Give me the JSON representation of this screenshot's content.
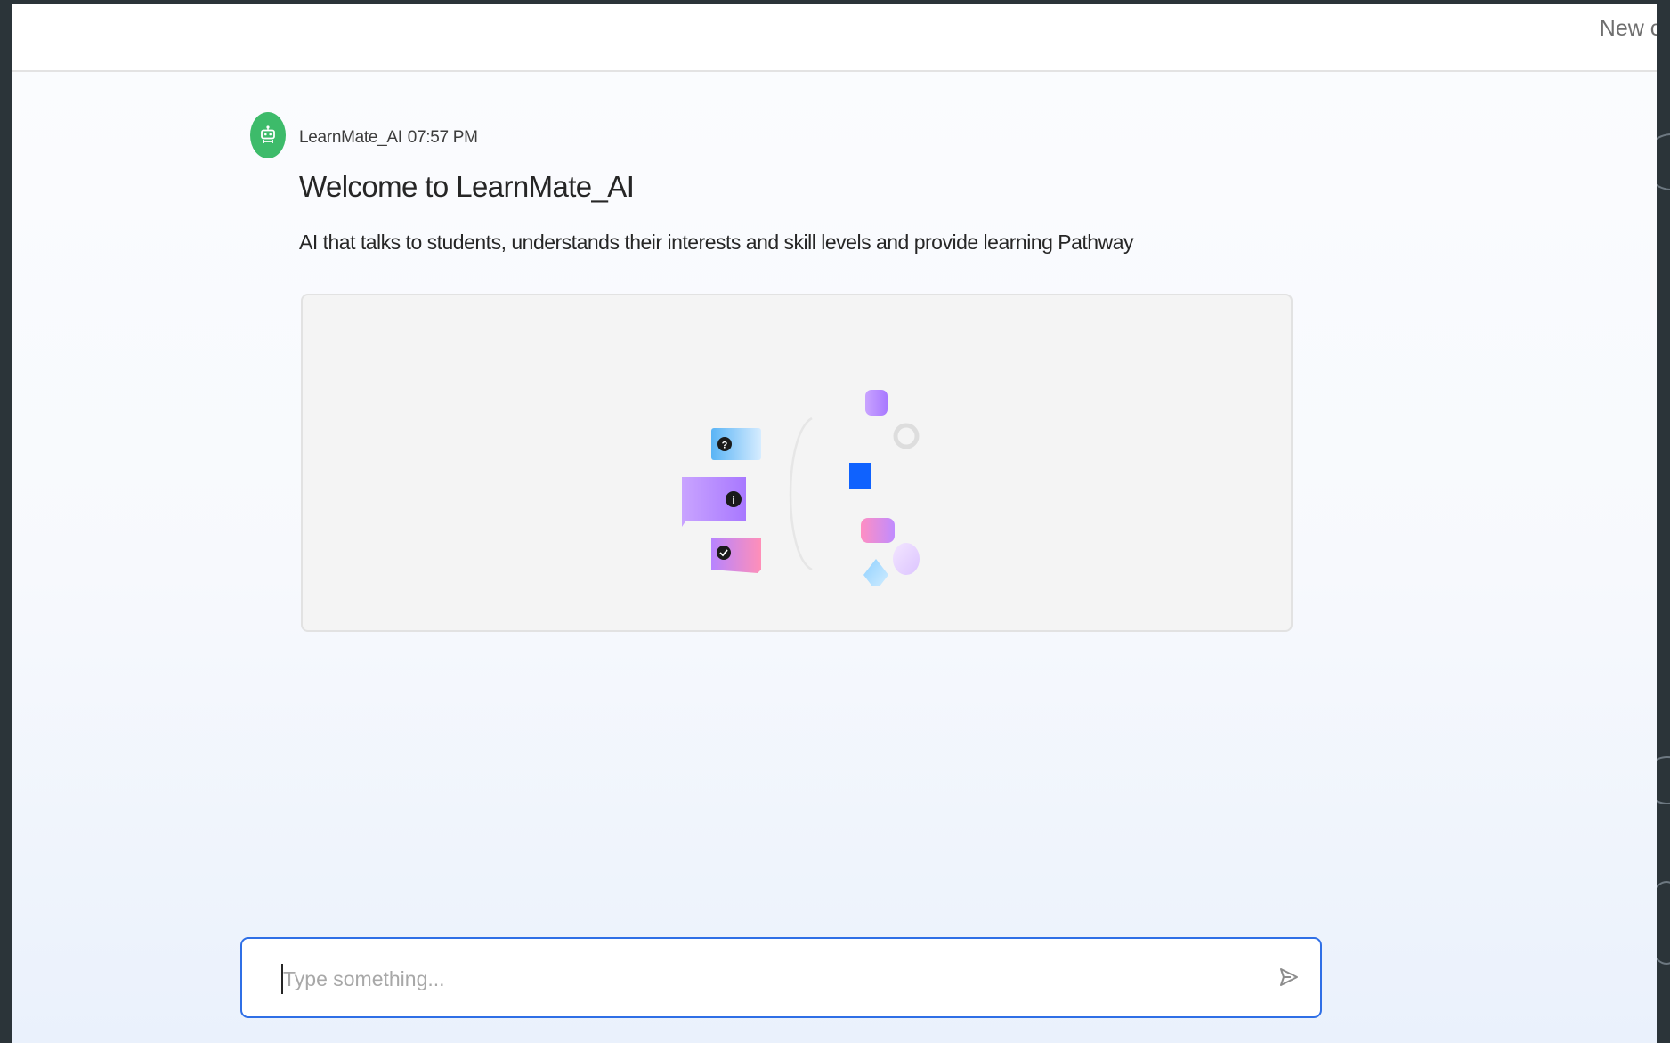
{
  "header": {
    "new_chat_label": "New chat"
  },
  "message": {
    "sender": "LearnMate_AI",
    "time": "07:57 PM",
    "title": "Welcome to LearnMate_AI",
    "description": "AI that talks to students, understands their interests and skill levels and provide learning Pathway"
  },
  "composer": {
    "placeholder": "Type something...",
    "value": ""
  },
  "colors": {
    "accent": "#2f6fe6",
    "avatar": "#3dbb6a",
    "illustration_square": "#0f62fe"
  },
  "icons": {
    "avatar": "robot-icon",
    "send": "send-icon",
    "bubbles": [
      "question-icon",
      "info-icon",
      "check-icon"
    ]
  }
}
